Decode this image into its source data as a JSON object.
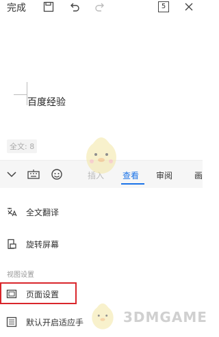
{
  "header": {
    "done_label": "完成",
    "page_indicator": "5",
    "icons": [
      "save-icon",
      "undo-icon",
      "redo-icon",
      "pages-icon",
      "close-icon"
    ]
  },
  "document": {
    "text": "百度经验"
  },
  "status": {
    "word_count": "全文: 8"
  },
  "toolbar": {
    "icons": [
      "chevron-down-icon",
      "keyboard-icon",
      "emoji-icon"
    ],
    "tabs": [
      {
        "label": "插入",
        "state": "muted"
      },
      {
        "label": "查看",
        "state": "active"
      },
      {
        "label": "审阅",
        "state": "normal"
      },
      {
        "label": "画",
        "state": "normal"
      }
    ]
  },
  "menu": {
    "items": [
      {
        "label": "全文翻译",
        "icon": "translate-icon"
      },
      {
        "label": "旋转屏幕",
        "icon": "rotate-screen-icon"
      }
    ],
    "section_title": "视图设置",
    "view_items": [
      {
        "label": "页面设置",
        "icon": "page-setup-icon",
        "highlighted": true
      },
      {
        "label": "默认开启适应手",
        "icon": "list-icon"
      }
    ]
  },
  "watermark": {
    "text": "3DMGAME"
  },
  "colors": {
    "accent": "#1a73e8",
    "highlight_border": "#d9262b"
  }
}
